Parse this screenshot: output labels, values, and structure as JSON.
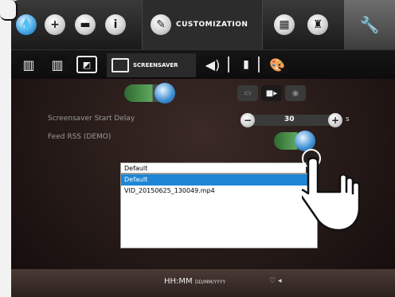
{
  "topbar": {
    "active_tab_label": "CUSTOMIZATION",
    "icons": [
      "water-drop-icon",
      "timer-icon",
      "chat-icon",
      "info-icon",
      "pen-icon",
      "calendar-icon",
      "chef-hat-icon",
      "wrench-icon"
    ]
  },
  "subbar": {
    "active_tab_label": "SCREENSAVER",
    "icons": [
      "book-icon",
      "book-images-icon",
      "slideshow-icon",
      "screensaver-icon",
      "speaker-icon",
      "usb-icon",
      "palette-icon"
    ]
  },
  "screensaver": {
    "enabled": true,
    "mode_options": [
      "image-mode-icon",
      "video-mode-icon",
      "disc-mode-icon"
    ],
    "active_mode": "video-mode-icon",
    "start_delay_label": "Screensaver Start Delay",
    "start_delay_value": "30",
    "start_delay_unit": "s",
    "rss_label": "Feed RSS (DEMO)",
    "rss_enabled": true
  },
  "dropdown": {
    "selected": "Default",
    "options": [
      "Default",
      "VID_20150625_130049.mp4"
    ],
    "highlighted_index": 0
  },
  "bottombar": {
    "clock_time": "HH:MM",
    "clock_date": "DD/MM/YYYY"
  },
  "colors": {
    "accent_blue": "#1f86d6",
    "toggle_green": "#5fa85f",
    "topbar": "#1a1a1a"
  }
}
